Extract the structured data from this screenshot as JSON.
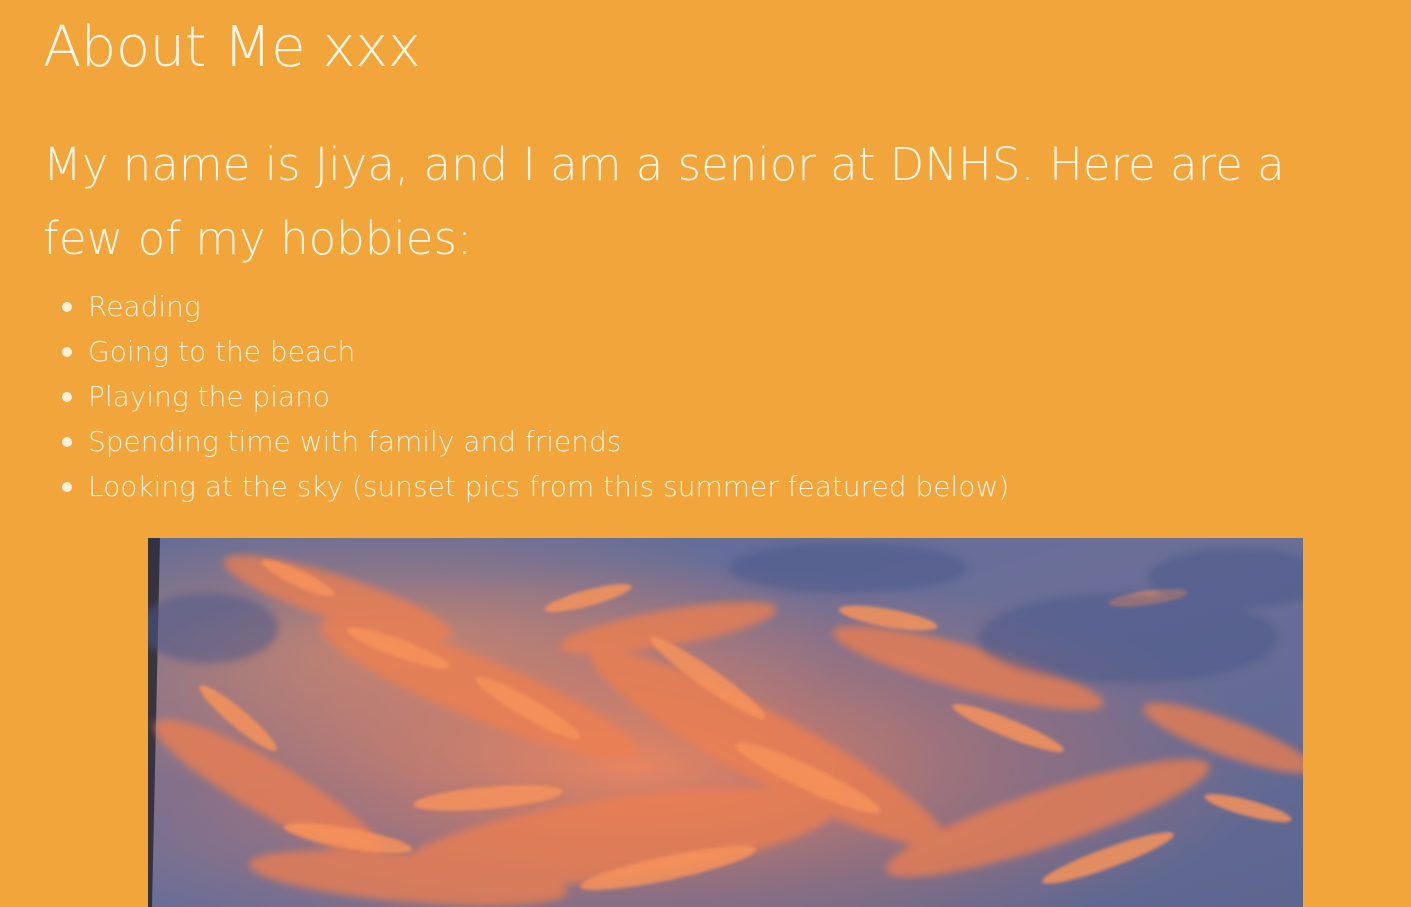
{
  "page": {
    "title": "About Me xxx",
    "intro": "My name is Jiya, and I am a senior at DNHS. Here are a few of my hobbies:"
  },
  "hobbies": [
    "Reading",
    "Going to the beach",
    "Playing the piano",
    "Spending time with family and friends",
    "Looking at the sky (sunset pics from this summer featured below)"
  ],
  "photo": {
    "subject": "sunset-sky-photo"
  },
  "colors": {
    "background": "#f2a53a",
    "text": "#fff6e8",
    "sky_blue": "#5e6f9e",
    "cloud_orange": "#f0824f"
  }
}
